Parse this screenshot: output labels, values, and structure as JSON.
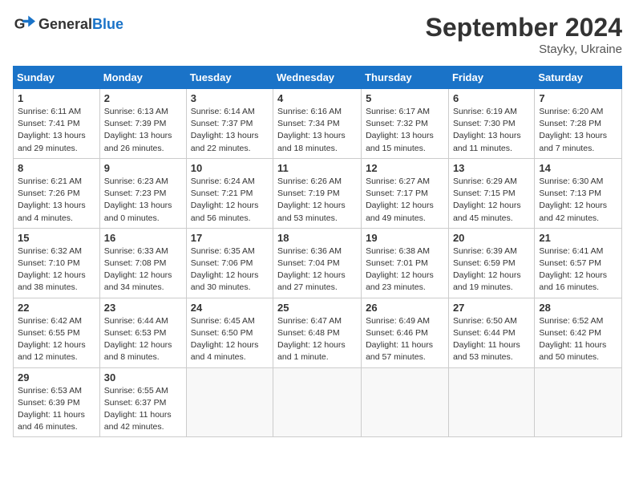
{
  "header": {
    "logo_general": "General",
    "logo_blue": "Blue",
    "month_title": "September 2024",
    "location": "Stayky, Ukraine"
  },
  "weekdays": [
    "Sunday",
    "Monday",
    "Tuesday",
    "Wednesday",
    "Thursday",
    "Friday",
    "Saturday"
  ],
  "weeks": [
    [
      {
        "day": "1",
        "info": "Sunrise: 6:11 AM\nSunset: 7:41 PM\nDaylight: 13 hours\nand 29 minutes."
      },
      {
        "day": "2",
        "info": "Sunrise: 6:13 AM\nSunset: 7:39 PM\nDaylight: 13 hours\nand 26 minutes."
      },
      {
        "day": "3",
        "info": "Sunrise: 6:14 AM\nSunset: 7:37 PM\nDaylight: 13 hours\nand 22 minutes."
      },
      {
        "day": "4",
        "info": "Sunrise: 6:16 AM\nSunset: 7:34 PM\nDaylight: 13 hours\nand 18 minutes."
      },
      {
        "day": "5",
        "info": "Sunrise: 6:17 AM\nSunset: 7:32 PM\nDaylight: 13 hours\nand 15 minutes."
      },
      {
        "day": "6",
        "info": "Sunrise: 6:19 AM\nSunset: 7:30 PM\nDaylight: 13 hours\nand 11 minutes."
      },
      {
        "day": "7",
        "info": "Sunrise: 6:20 AM\nSunset: 7:28 PM\nDaylight: 13 hours\nand 7 minutes."
      }
    ],
    [
      {
        "day": "8",
        "info": "Sunrise: 6:21 AM\nSunset: 7:26 PM\nDaylight: 13 hours\nand 4 minutes."
      },
      {
        "day": "9",
        "info": "Sunrise: 6:23 AM\nSunset: 7:23 PM\nDaylight: 13 hours\nand 0 minutes."
      },
      {
        "day": "10",
        "info": "Sunrise: 6:24 AM\nSunset: 7:21 PM\nDaylight: 12 hours\nand 56 minutes."
      },
      {
        "day": "11",
        "info": "Sunrise: 6:26 AM\nSunset: 7:19 PM\nDaylight: 12 hours\nand 53 minutes."
      },
      {
        "day": "12",
        "info": "Sunrise: 6:27 AM\nSunset: 7:17 PM\nDaylight: 12 hours\nand 49 minutes."
      },
      {
        "day": "13",
        "info": "Sunrise: 6:29 AM\nSunset: 7:15 PM\nDaylight: 12 hours\nand 45 minutes."
      },
      {
        "day": "14",
        "info": "Sunrise: 6:30 AM\nSunset: 7:13 PM\nDaylight: 12 hours\nand 42 minutes."
      }
    ],
    [
      {
        "day": "15",
        "info": "Sunrise: 6:32 AM\nSunset: 7:10 PM\nDaylight: 12 hours\nand 38 minutes."
      },
      {
        "day": "16",
        "info": "Sunrise: 6:33 AM\nSunset: 7:08 PM\nDaylight: 12 hours\nand 34 minutes."
      },
      {
        "day": "17",
        "info": "Sunrise: 6:35 AM\nSunset: 7:06 PM\nDaylight: 12 hours\nand 30 minutes."
      },
      {
        "day": "18",
        "info": "Sunrise: 6:36 AM\nSunset: 7:04 PM\nDaylight: 12 hours\nand 27 minutes."
      },
      {
        "day": "19",
        "info": "Sunrise: 6:38 AM\nSunset: 7:01 PM\nDaylight: 12 hours\nand 23 minutes."
      },
      {
        "day": "20",
        "info": "Sunrise: 6:39 AM\nSunset: 6:59 PM\nDaylight: 12 hours\nand 19 minutes."
      },
      {
        "day": "21",
        "info": "Sunrise: 6:41 AM\nSunset: 6:57 PM\nDaylight: 12 hours\nand 16 minutes."
      }
    ],
    [
      {
        "day": "22",
        "info": "Sunrise: 6:42 AM\nSunset: 6:55 PM\nDaylight: 12 hours\nand 12 minutes."
      },
      {
        "day": "23",
        "info": "Sunrise: 6:44 AM\nSunset: 6:53 PM\nDaylight: 12 hours\nand 8 minutes."
      },
      {
        "day": "24",
        "info": "Sunrise: 6:45 AM\nSunset: 6:50 PM\nDaylight: 12 hours\nand 4 minutes."
      },
      {
        "day": "25",
        "info": "Sunrise: 6:47 AM\nSunset: 6:48 PM\nDaylight: 12 hours\nand 1 minute."
      },
      {
        "day": "26",
        "info": "Sunrise: 6:49 AM\nSunset: 6:46 PM\nDaylight: 11 hours\nand 57 minutes."
      },
      {
        "day": "27",
        "info": "Sunrise: 6:50 AM\nSunset: 6:44 PM\nDaylight: 11 hours\nand 53 minutes."
      },
      {
        "day": "28",
        "info": "Sunrise: 6:52 AM\nSunset: 6:42 PM\nDaylight: 11 hours\nand 50 minutes."
      }
    ],
    [
      {
        "day": "29",
        "info": "Sunrise: 6:53 AM\nSunset: 6:39 PM\nDaylight: 11 hours\nand 46 minutes."
      },
      {
        "day": "30",
        "info": "Sunrise: 6:55 AM\nSunset: 6:37 PM\nDaylight: 11 hours\nand 42 minutes."
      },
      {
        "day": "",
        "info": ""
      },
      {
        "day": "",
        "info": ""
      },
      {
        "day": "",
        "info": ""
      },
      {
        "day": "",
        "info": ""
      },
      {
        "day": "",
        "info": ""
      }
    ]
  ]
}
